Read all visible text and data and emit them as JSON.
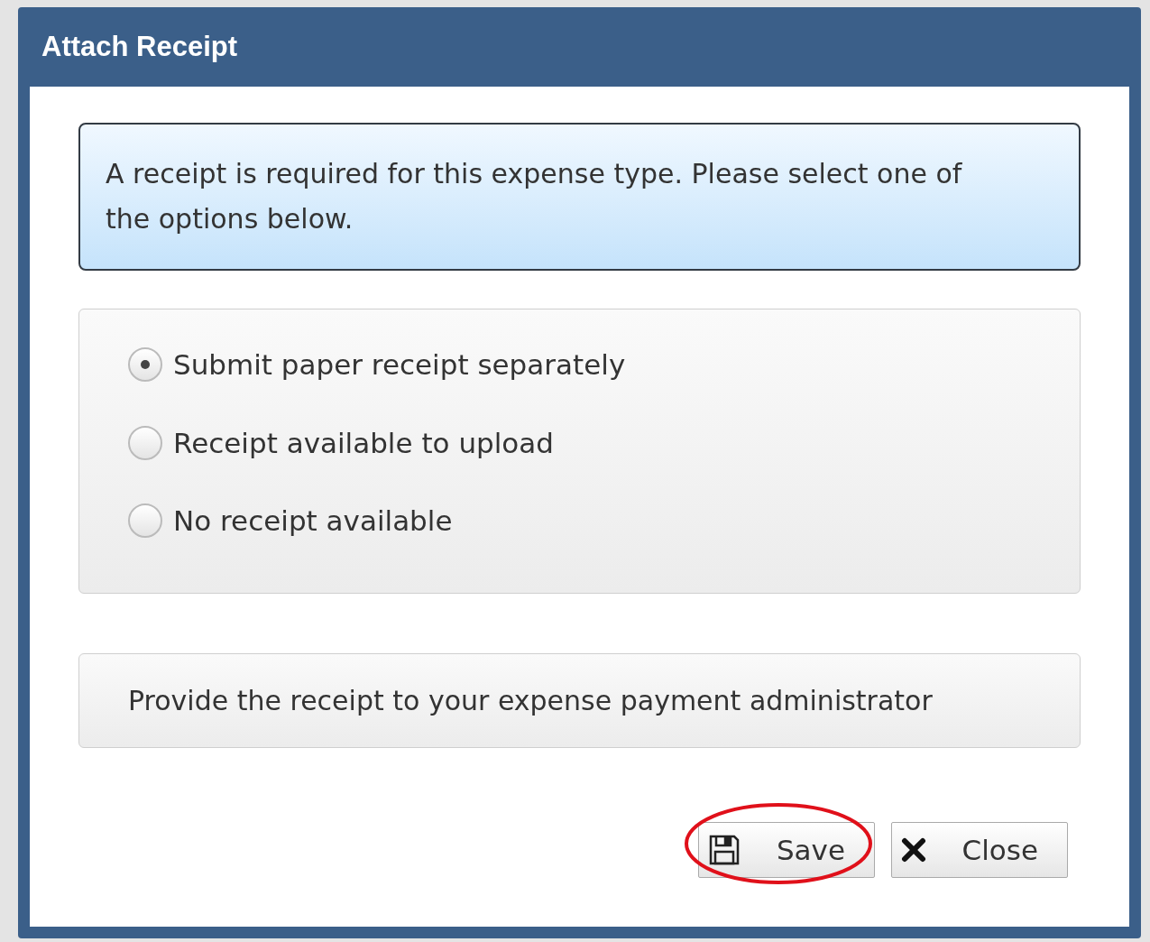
{
  "dialog": {
    "title": "Attach Receipt"
  },
  "message": "A receipt is required for this expense type. Please select one of the options below.",
  "options": [
    {
      "label": "Submit paper receipt separately",
      "selected": true
    },
    {
      "label": "Receipt available to upload",
      "selected": false
    },
    {
      "label": "No receipt available",
      "selected": false
    }
  ],
  "note": "Provide the receipt to your expense payment administrator",
  "buttons": [
    {
      "label": "Save",
      "kind": "save",
      "highlighted": true
    },
    {
      "label": "Close",
      "kind": "close",
      "highlighted": false
    }
  ]
}
